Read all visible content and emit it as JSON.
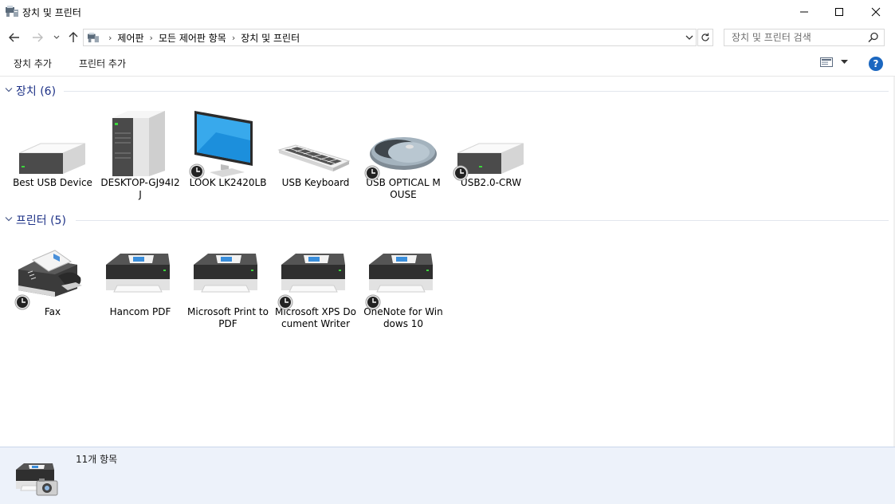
{
  "window": {
    "title": "장치 및 프린터"
  },
  "address": {
    "crumbs": [
      "제어판",
      "모든 제어판 항목",
      "장치 및 프린터"
    ]
  },
  "search": {
    "placeholder": "장치 및 프린터 검색"
  },
  "commands": {
    "add_device": "장치 추가",
    "add_printer": "프린터 추가",
    "help": "?"
  },
  "sections": {
    "devices": {
      "title": "장치 (6)",
      "items": [
        {
          "label": "Best USB Device",
          "icon": "external-drive-icon",
          "badge": false
        },
        {
          "label": "DESKTOP-GJ94I2J",
          "icon": "computer-tower-icon",
          "badge": false
        },
        {
          "label": "LOOK LK2420LB",
          "icon": "monitor-icon",
          "badge": true
        },
        {
          "label": "USB Keyboard",
          "icon": "keyboard-icon",
          "badge": false
        },
        {
          "label": "USB OPTICAL MOUSE",
          "icon": "mouse-icon",
          "badge": true
        },
        {
          "label": "USB2.0-CRW",
          "icon": "external-drive-icon",
          "badge": true
        }
      ]
    },
    "printers": {
      "title": "프린터 (5)",
      "items": [
        {
          "label": "Fax",
          "icon": "fax-icon",
          "badge": true
        },
        {
          "label": "Hancom PDF",
          "icon": "printer-icon",
          "badge": false
        },
        {
          "label": "Microsoft Print to PDF",
          "icon": "printer-icon",
          "badge": false
        },
        {
          "label": "Microsoft XPS Document Writer",
          "icon": "printer-icon",
          "badge": true
        },
        {
          "label": "OneNote for Windows 10",
          "icon": "printer-icon",
          "badge": true
        }
      ]
    }
  },
  "details": {
    "count": "11개 항목"
  },
  "colors": {
    "section_title": "#1e3287",
    "details_bg": "#edf2fa",
    "help_blue": "#1b67c0"
  }
}
